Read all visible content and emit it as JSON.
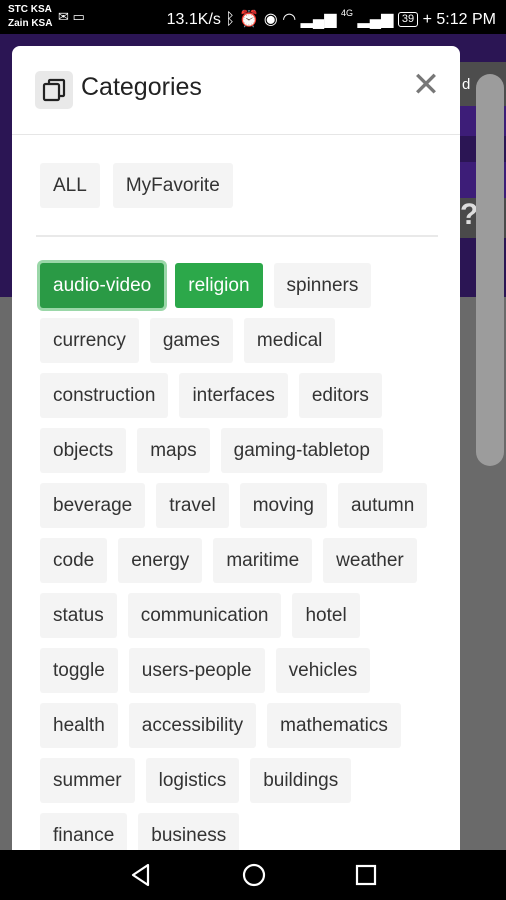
{
  "status_bar": {
    "carrier1": "STC KSA",
    "carrier2": "Zain KSA",
    "net_speed": "13.1K/s",
    "signal_label": "4G",
    "battery": "39",
    "time": "5:12 PM"
  },
  "background": {
    "partial_text": "d"
  },
  "modal": {
    "title": "Categories",
    "close_symbol": "✕",
    "filters": [
      "ALL",
      "MyFavorite"
    ],
    "tags": [
      "audio-video",
      "religion",
      "spinners",
      "currency",
      "games",
      "medical",
      "construction",
      "interfaces",
      "editors",
      "objects",
      "maps",
      "gaming-tabletop",
      "beverage",
      "travel",
      "moving",
      "autumn",
      "code",
      "energy",
      "maritime",
      "weather",
      "status",
      "communication",
      "hotel",
      "toggle",
      "users-people",
      "vehicles",
      "health",
      "accessibility",
      "mathematics",
      "summer",
      "logistics",
      "buildings",
      "finance",
      "business"
    ],
    "active_tags": [
      "audio-video",
      "religion"
    ],
    "accent_color": "#2ca84a"
  },
  "nav_bar": {
    "buttons": [
      "back-icon",
      "home-icon",
      "recents-icon"
    ]
  }
}
